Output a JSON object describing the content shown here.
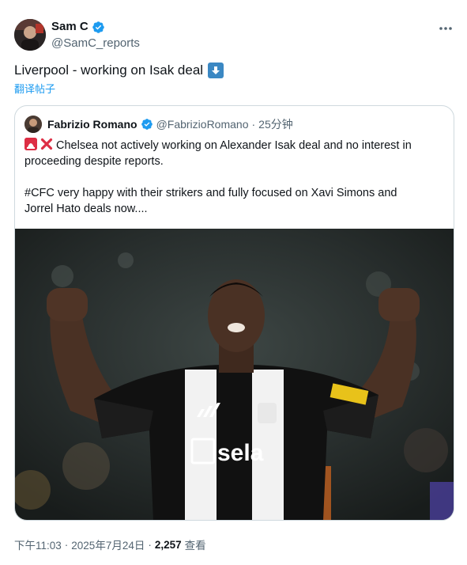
{
  "author": {
    "display_name": "Sam C",
    "handle": "@SamC_reports"
  },
  "tweet": {
    "text": "Liverpool - working on Isak deal",
    "translate_label": "翻译帖子"
  },
  "quoted": {
    "display_name": "Fabrizio Romano",
    "handle": "@FabrizioRomano",
    "separator": "·",
    "time": "25分钟",
    "lines": [
      "Chelsea not actively working on Alexander Isak deal and no interest in",
      "proceeding despite reports.",
      "#CFC very happy with their strikers and fully focused on Xavi Simons and",
      "Jorrel Hato deals now...."
    ],
    "photo": {
      "shirt_sponsor": "sela"
    }
  },
  "footer": {
    "time": "下午11:03",
    "sep1": "·",
    "date": "2025年7月24日",
    "sep2": "·",
    "views_count": "2,257",
    "views_label": "查看"
  },
  "icons": {
    "verified": "verified-badge-icon",
    "more": "more-horizontal-icon",
    "down_arrow": "down-arrow-emoji",
    "siren": "police-light-emoji",
    "cross": "cross-mark-emoji"
  },
  "colors": {
    "link": "#1d9bf0",
    "secondary_text": "#536471",
    "border": "#cfd9de",
    "verified": "#1d9bf0"
  }
}
